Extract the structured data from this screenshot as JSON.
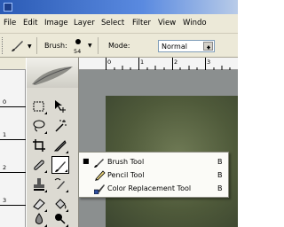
{
  "menubar": {
    "items": [
      "File",
      "Edit",
      "Image",
      "Layer",
      "Select",
      "Filter",
      "View",
      "Windo"
    ]
  },
  "options_bar": {
    "brush_label": "Brush:",
    "brush_size": "54",
    "mode_label": "Mode:",
    "mode_value": "Normal"
  },
  "rulers": {
    "horizontal": [
      "0",
      "1",
      "2",
      "3"
    ],
    "vertical": [
      "0",
      "1",
      "2",
      "3"
    ]
  },
  "flyout": {
    "items": [
      {
        "label": "Brush Tool",
        "shortcut": "B",
        "selected": true,
        "icon": "brush-icon"
      },
      {
        "label": "Pencil Tool",
        "shortcut": "B",
        "selected": false,
        "icon": "pencil-icon"
      },
      {
        "label": "Color Replacement Tool",
        "shortcut": "B",
        "selected": false,
        "icon": "color-replacement-icon"
      }
    ],
    "bullet": "■"
  },
  "colors": {
    "titlebar": "#2b5bb5",
    "chrome": "#ece9d8",
    "canvas": "#4f5a3a"
  }
}
